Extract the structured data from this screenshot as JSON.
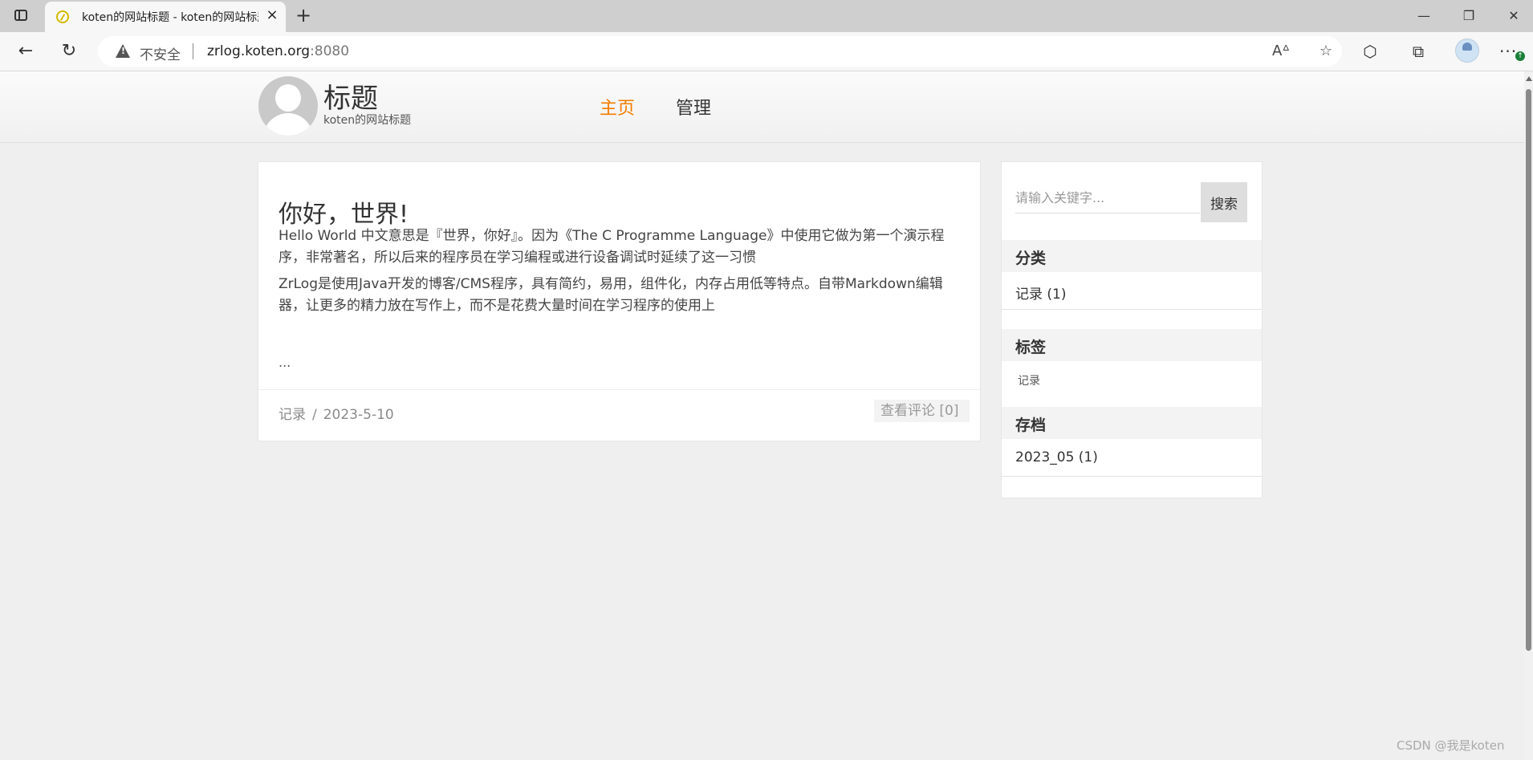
{
  "browser": {
    "tab_title": "koten的网站标题 - koten的网站标题",
    "tab_close": "×",
    "new_tab": "+",
    "window": {
      "minimize": "—",
      "restore": "❐",
      "close": "✕"
    },
    "back": "←",
    "reload": "↻",
    "insecure_label": "不安全",
    "url_host": "zrlog.koten.org",
    "url_port": ":8080",
    "icons": {
      "read_aloud": "Aᐞ",
      "favorite": "☆",
      "extensions": "⬡",
      "collections": "⧉",
      "more": "···"
    }
  },
  "site": {
    "title": "标题",
    "subtitle": "koten的网站标题",
    "nav": {
      "home": "主页",
      "admin": "管理"
    },
    "home_color": "#f57c00"
  },
  "post": {
    "title": "你好，世界!",
    "paragraphs": [
      "Hello World 中文意思是『世界，你好』。因为《The C Programme Language》中使用它做为第一个演示程序，非常著名，所以后来的程序员在学习编程或进行设备调试时延续了这一习惯",
      "ZrLog是使用Java开发的博客/CMS程序，具有简约，易用，组件化，内存占用低等特点。自带Markdown编辑器，让更多的精力放在写作上，而不是花费大量时间在学习程序的使用上"
    ],
    "ellipsis": "...",
    "category": "记录",
    "separator": "/",
    "date": "2023-5-10",
    "comments": "查看评论 [0]"
  },
  "sidebar": {
    "search_placeholder": "请输入关键字...",
    "search_button": "搜索",
    "categories_title": "分类",
    "categories": [
      "记录 (1)"
    ],
    "tags_title": "标签",
    "tags": [
      "记录"
    ],
    "archives_title": "存档",
    "archives": [
      "2023_05 (1)"
    ]
  },
  "watermark": "CSDN @我是koten"
}
